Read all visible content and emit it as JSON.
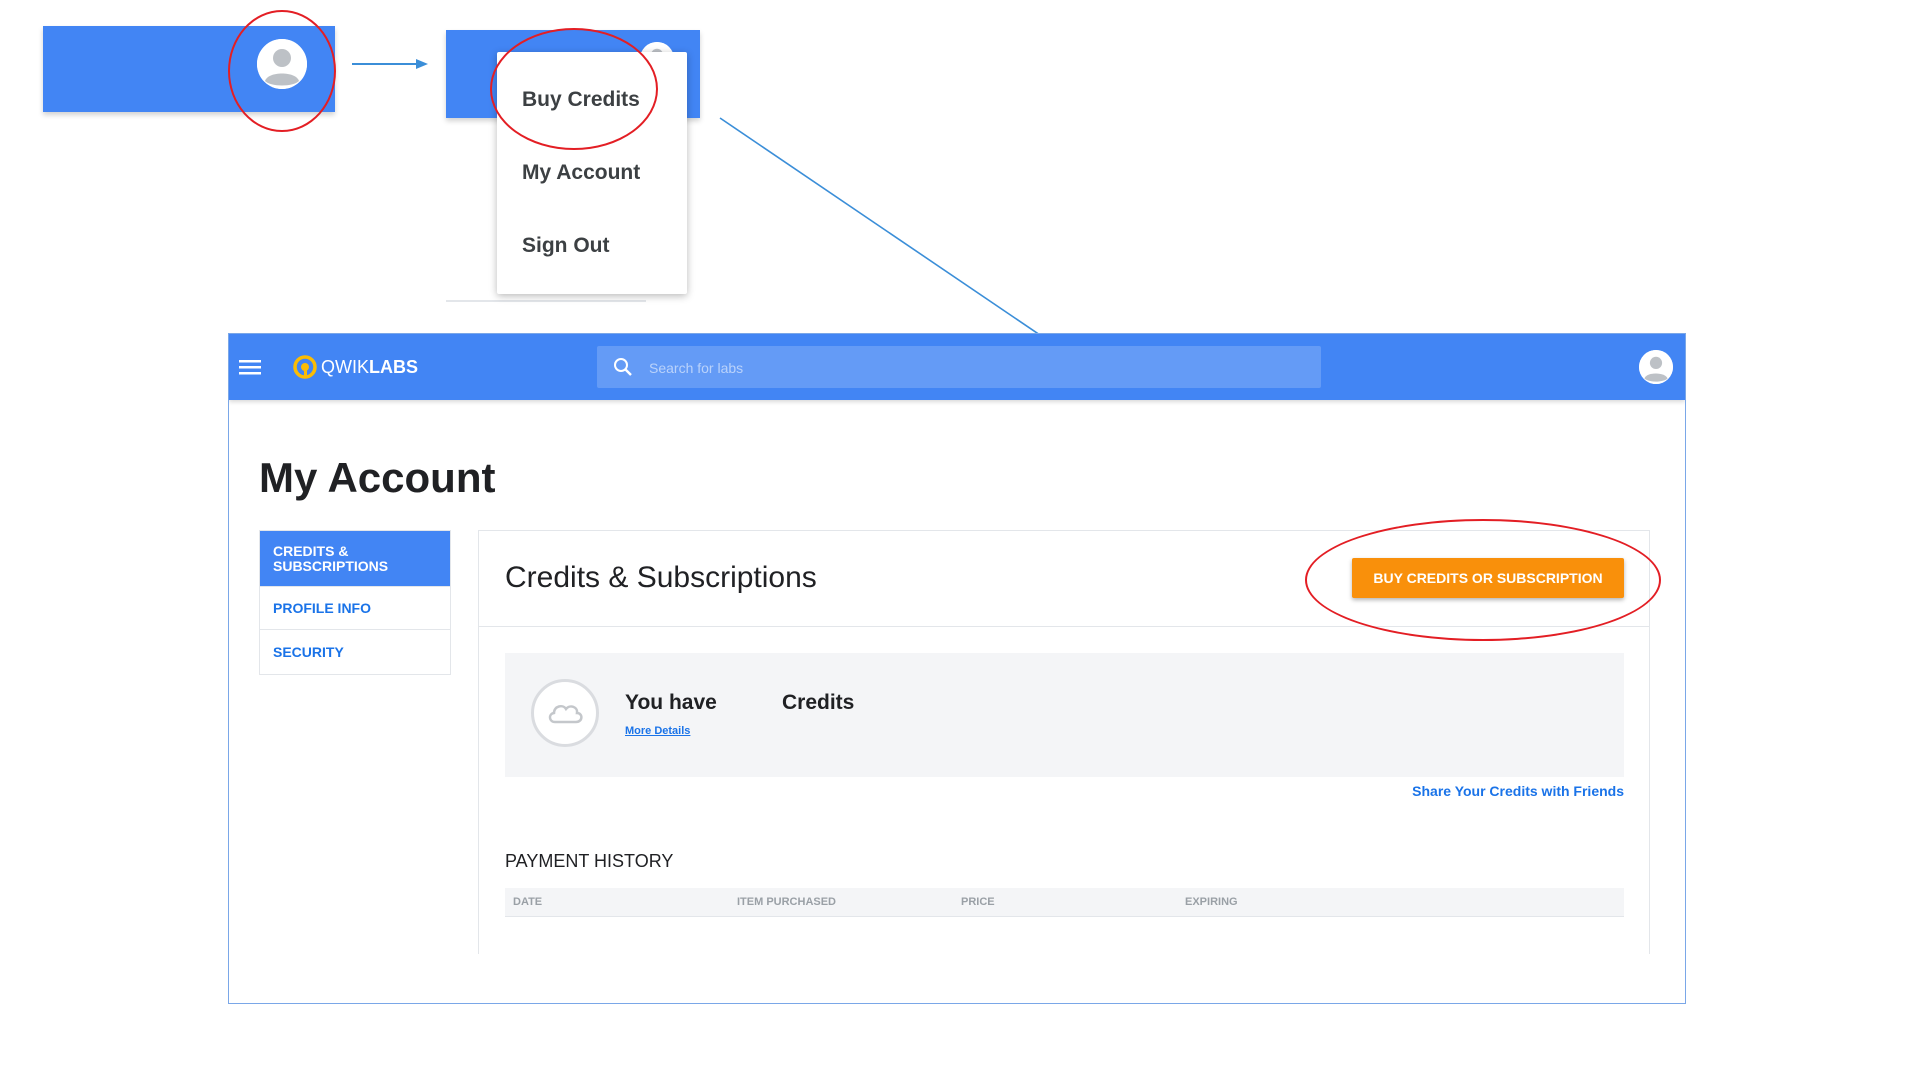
{
  "dropdown": {
    "items": [
      "Buy Credits",
      "My Account",
      "Sign Out"
    ]
  },
  "app": {
    "brand_prefix": "QWIK",
    "brand_suffix": "LABS",
    "search_placeholder": "Search for labs"
  },
  "page": {
    "title": "My Account"
  },
  "sidebar": {
    "items": [
      {
        "label": "Credits & Subscriptions",
        "active": true
      },
      {
        "label": "Profile Info",
        "active": false
      },
      {
        "label": "Security",
        "active": false
      }
    ]
  },
  "card": {
    "title": "Credits & Subscriptions",
    "buy_button": "BUY CREDITS OR SUBSCRIPTION",
    "you_have": "You have",
    "credits_word": "Credits",
    "more_details": "More Details",
    "share_link": "Share Your Credits with Friends"
  },
  "payment_history": {
    "title": "PAYMENT HISTORY",
    "columns": [
      "DATE",
      "ITEM PURCHASED",
      "PRICE",
      "EXPIRING"
    ]
  },
  "colors": {
    "primary_blue": "#4285f4",
    "accent_orange": "#f9900b",
    "annotation_red": "#e31e24",
    "arrow_blue": "#3b8ed8"
  },
  "icons": {
    "avatar": "person-avatar-icon",
    "menu": "hamburger-menu-icon",
    "search": "search-icon",
    "logo": "qwiklabs-logo-icon",
    "credit_badge": "cloud-badge-icon"
  }
}
